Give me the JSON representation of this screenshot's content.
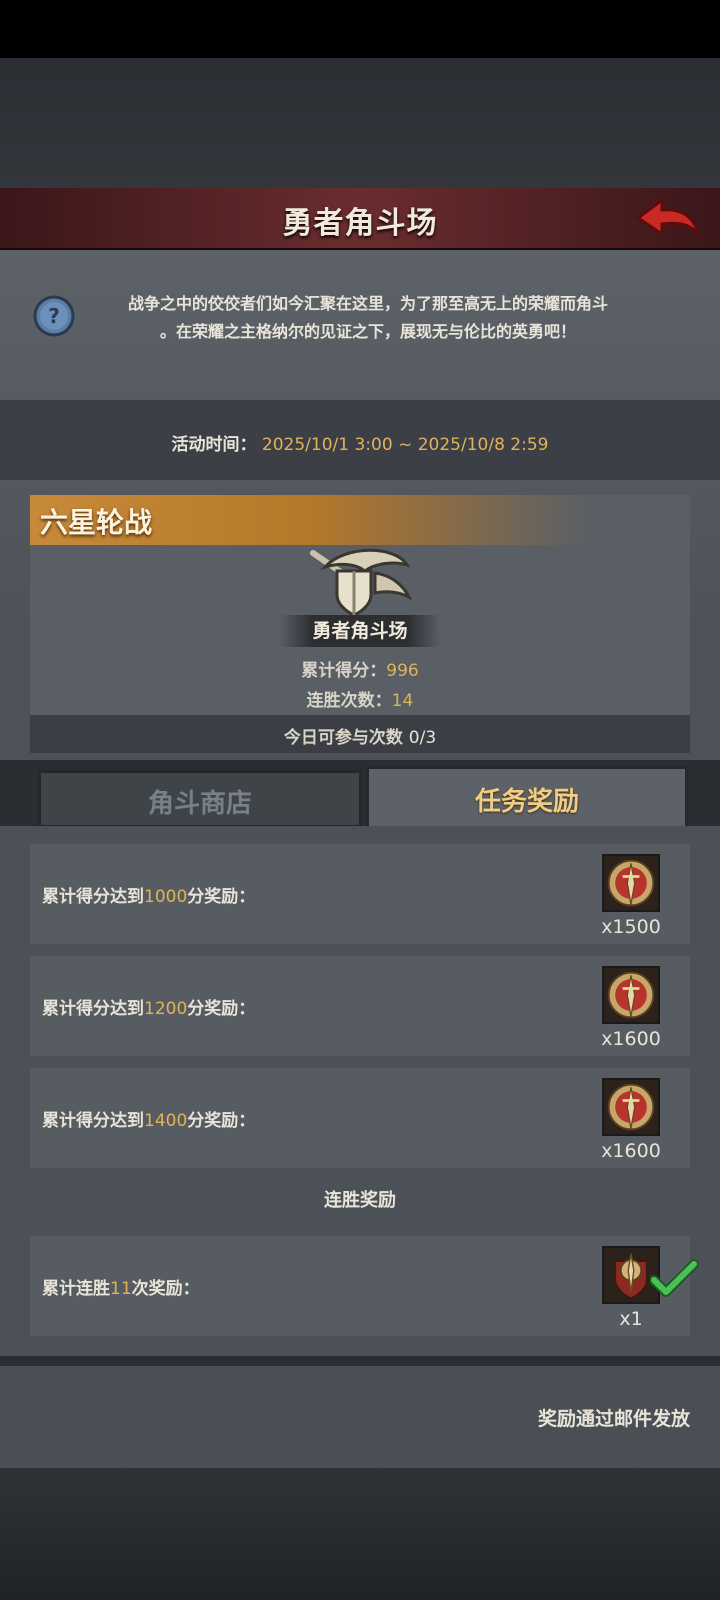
{
  "header": {
    "title": "勇者角斗场"
  },
  "description": {
    "line1": "战争之中的佼佼者们如今汇聚在这里，为了那至高无上的荣耀而角斗",
    "line2": "。在荣耀之主格纳尔的见证之下，展现无与伦比的英勇吧！"
  },
  "event_time": {
    "label": "活动时间：",
    "value": "2025/10/1 3:00 ~ 2025/10/8 2:59"
  },
  "card": {
    "tag": "六星轮战",
    "arena_name": "勇者角斗场",
    "score_label": "累计得分：",
    "score_value": "996",
    "streak_label": "连胜次数：",
    "streak_value": "14",
    "today_label": "今日可参与次数",
    "today_value": "0/3"
  },
  "tabs": {
    "shop": "角斗商店",
    "tasks": "任务奖励",
    "active": "tasks"
  },
  "rewards": [
    {
      "prefix": "累计得分达到",
      "num": "1000",
      "suffix": "分奖励：",
      "qty": "x1500",
      "icon": "medal-icon",
      "claimed": false
    },
    {
      "prefix": "累计得分达到",
      "num": "1200",
      "suffix": "分奖励：",
      "qty": "x1600",
      "icon": "medal-icon",
      "claimed": false
    },
    {
      "prefix": "累计得分达到",
      "num": "1400",
      "suffix": "分奖励：",
      "qty": "x1600",
      "icon": "medal-icon",
      "claimed": false
    }
  ],
  "streak_section": {
    "title": "连胜奖励",
    "items": [
      {
        "prefix": "累计连胜",
        "num": "11",
        "suffix": "次奖励：",
        "qty": "x1",
        "icon": "sword-badge-icon",
        "claimed": true
      }
    ]
  },
  "footer": {
    "note": "奖励通过邮件发放"
  },
  "colors": {
    "accent_gold": "#e0b25a",
    "header_red": "#6a2d2f",
    "tag_orange": "#c78a3a",
    "check_green": "#3fb84a"
  }
}
